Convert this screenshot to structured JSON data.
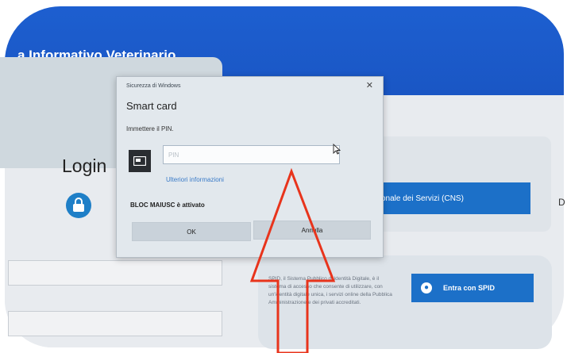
{
  "page": {
    "site_title": "a Informativo Veterinario",
    "login_title": "Login",
    "cns_button": "onale dei Servizi (CNS)",
    "edge_letter": "D",
    "spid_text": "SPID, il Sistema Pubblico di Identità Digitale, è il sistema di accesso che consente di utilizzare, con un'identità digitale unica, i servizi online della Pubblica Amministrazione e dei privati accreditati.",
    "spid_button": "Entra con SPID"
  },
  "dialog": {
    "caption": "Sicurezza di Windows",
    "close": "✕",
    "title": "Smart card",
    "prompt": "Immettere il PIN.",
    "pin_placeholder": "PIN",
    "pin_value": "",
    "more_info": "Ulteriori informazioni",
    "caps_warning": "BLOC MAIUSC è attivato",
    "ok": "OK",
    "cancel": "Annulla"
  },
  "icons": {
    "lock": "lock-icon",
    "smartcard": "smart-card-icon",
    "spid": "user-icon",
    "cursor": "mouse-cursor-icon",
    "arrow": "red-arrow-annotation"
  },
  "colors": {
    "header_blue": "#1a56c4",
    "button_blue": "#1c70c8",
    "arrow_red": "#e8341c"
  }
}
